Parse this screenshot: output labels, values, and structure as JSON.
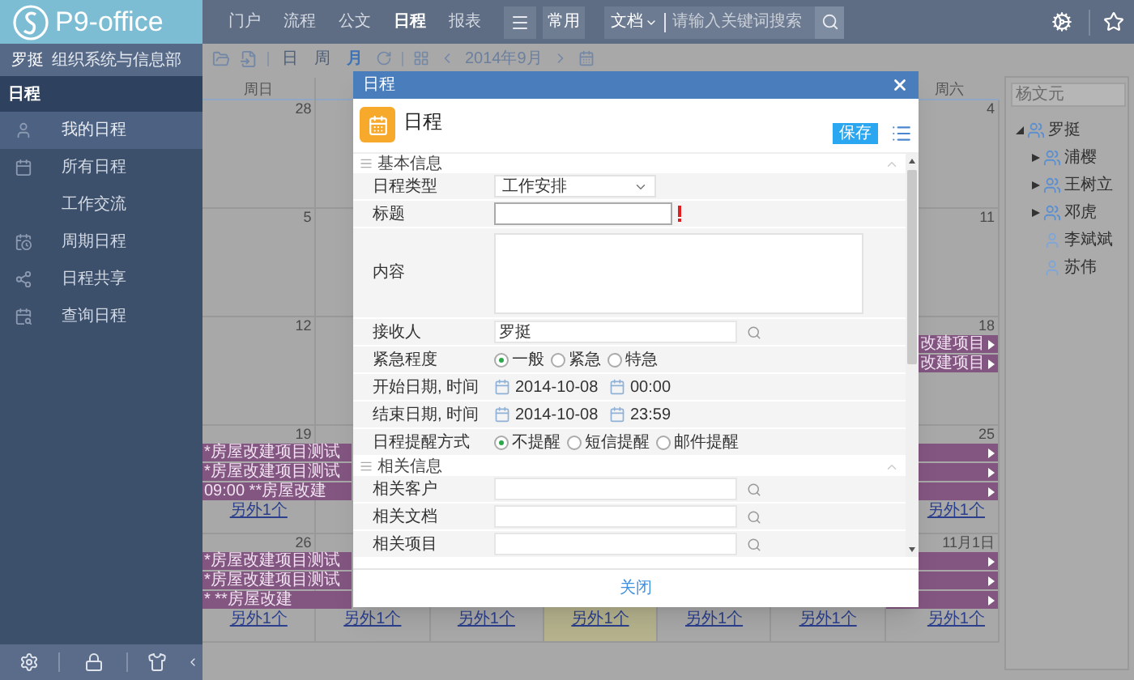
{
  "header": {
    "logo": "P9-office",
    "nav": [
      {
        "label": "门户",
        "selected": false
      },
      {
        "label": "流程",
        "selected": false
      },
      {
        "label": "公文",
        "selected": false
      },
      {
        "label": "日程",
        "selected": true
      },
      {
        "label": "报表",
        "selected": false
      }
    ],
    "common_button": "常用",
    "search": {
      "scope": "文档",
      "placeholder": "请输入关键词搜索"
    }
  },
  "sidebar": {
    "user": "罗挺",
    "department": "组织系统与信息部",
    "section": "日程",
    "items": [
      {
        "label": "我的日程",
        "selected": true
      },
      {
        "label": "所有日程",
        "selected": false
      },
      {
        "label": "工作交流",
        "selected": false
      },
      {
        "label": "周期日程",
        "selected": false
      },
      {
        "label": "日程共享",
        "selected": false
      },
      {
        "label": "查询日程",
        "selected": false
      }
    ]
  },
  "toolbar": {
    "views": [
      {
        "label": "日",
        "selected": false
      },
      {
        "label": "周",
        "selected": false
      },
      {
        "label": "月",
        "selected": true
      }
    ],
    "month": "2014年9月"
  },
  "calendar": {
    "first_weekday": "周日",
    "last_weekday": "周六",
    "weeks": [
      {
        "first": {
          "date": "28"
        },
        "last": {
          "date": "4"
        }
      },
      {
        "first": {
          "date": "5"
        },
        "last": {
          "date": "11"
        }
      },
      {
        "first": {
          "date": "12"
        },
        "last": {
          "date": "18",
          "events": [
            {
              "text": "改建项目",
              "continues": true
            },
            {
              "text": "改建项目",
              "continues": true
            }
          ]
        }
      },
      {
        "first": {
          "date": "19",
          "events": [
            {
              "text": "*房屋改建项目测试",
              "continues": false
            },
            {
              "text": "*房屋改建项目测试",
              "continues": false
            },
            {
              "text": "09:00 **房屋改建",
              "continues": false
            }
          ],
          "more": "另外1个"
        },
        "last": {
          "date": "25",
          "events": [
            {
              "continues": true
            },
            {
              "continues": true
            },
            {
              "continues": true
            }
          ],
          "more": "另外1个"
        }
      },
      {
        "first": {
          "date": "26",
          "events": [
            {
              "text": "*房屋改建项目测试",
              "continues": false
            },
            {
              "text": "*房屋改建项目测试",
              "continues": false
            },
            {
              "text": "* **房屋改建",
              "continues": false
            }
          ],
          "more": "另外1个"
        },
        "last": {
          "date": "11月1日",
          "events": [
            {
              "continues": true
            },
            {
              "continues": true
            },
            {
              "continues": true
            }
          ],
          "more": "另外1个"
        }
      }
    ],
    "bottom_links": [
      {
        "label": "另外1个",
        "today": false
      },
      {
        "label": "另外1个",
        "today": false
      },
      {
        "label": "另外1个",
        "today": true
      },
      {
        "label": "另外1个",
        "today": false
      },
      {
        "label": "另外1个",
        "today": false
      }
    ]
  },
  "people_panel": {
    "search": {
      "placeholder": "杨文元"
    },
    "tree": [
      {
        "label": "罗挺",
        "kind": "group",
        "expanded": true,
        "children": [
          {
            "label": "浦樱",
            "kind": "group",
            "expanded": false
          },
          {
            "label": "王树立",
            "kind": "group",
            "expanded": false
          },
          {
            "label": "邓虎",
            "kind": "group",
            "expanded": false
          },
          {
            "label": "李斌斌",
            "kind": "person"
          },
          {
            "label": "苏伟",
            "kind": "person"
          }
        ]
      }
    ]
  },
  "dialog": {
    "title": "日程",
    "heading": "日程",
    "save_button": "保存",
    "sections": [
      {
        "title": "基本信息",
        "expanded": true,
        "fields": [
          {
            "kind": "select",
            "label": "日程类型",
            "value": "工作安排"
          },
          {
            "kind": "text",
            "label": "标题",
            "required": true
          },
          {
            "kind": "textarea",
            "label": "内容"
          },
          {
            "kind": "lookup",
            "label": "接收人",
            "value": "罗挺"
          },
          {
            "kind": "radio",
            "label": "紧急程度",
            "options": [
              {
                "label": "一般",
                "selected": true
              },
              {
                "label": "紧急",
                "selected": false
              },
              {
                "label": "特急",
                "selected": false
              }
            ]
          },
          {
            "kind": "datetime",
            "label": "开始日期, 时间",
            "date": "2014-10-08",
            "time": "00:00"
          },
          {
            "kind": "datetime",
            "label": "结束日期, 时间",
            "date": "2014-10-08",
            "time": "23:59"
          },
          {
            "kind": "radio",
            "label": "日程提醒方式",
            "options": [
              {
                "label": "不提醒",
                "selected": true
              },
              {
                "label": "短信提醒",
                "selected": false
              },
              {
                "label": "邮件提醒",
                "selected": false
              }
            ]
          }
        ]
      },
      {
        "title": "相关信息",
        "expanded": true,
        "fields": [
          {
            "kind": "lookup",
            "label": "相关客户"
          },
          {
            "kind": "lookup",
            "label": "相关文档"
          },
          {
            "kind": "lookup",
            "label": "相关项目"
          }
        ]
      }
    ],
    "close_button": "关闭"
  }
}
